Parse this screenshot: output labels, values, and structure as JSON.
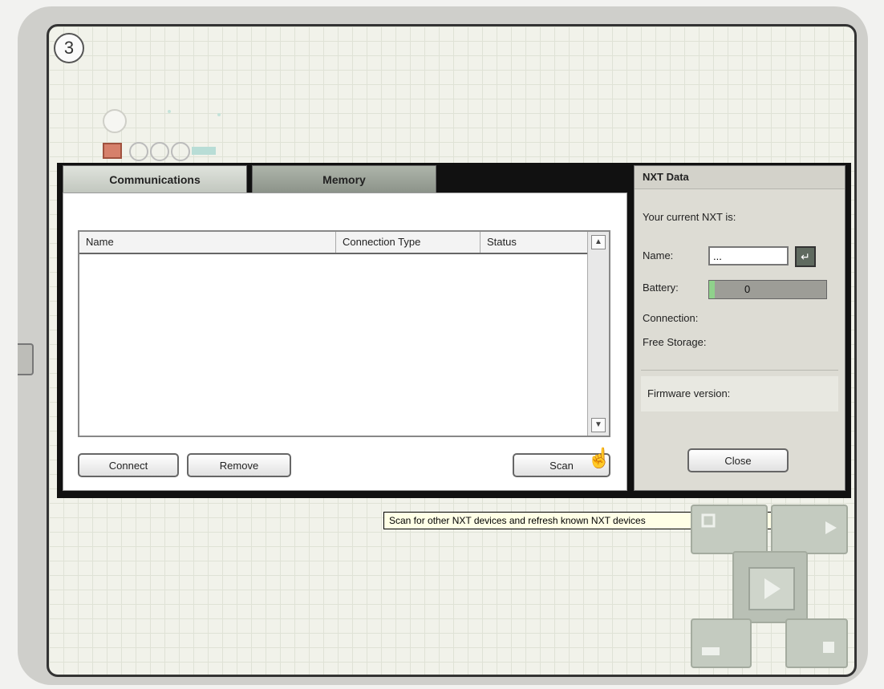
{
  "step_number": "3",
  "dialog": {
    "tabs": [
      "Communications",
      "Memory"
    ],
    "list": {
      "columns": [
        "Name",
        "Connection Type",
        "Status"
      ],
      "rows": []
    },
    "buttons": {
      "connect": "Connect",
      "remove": "Remove",
      "scan": "Scan"
    },
    "tooltip": "Scan for other NXT devices and refresh known NXT devices"
  },
  "nxt_panel": {
    "title": "NXT Data",
    "subtitle": "Your current NXT is:",
    "name_label": "Name:",
    "name_value": "...",
    "name_button": "↵",
    "battery_label": "Battery:",
    "battery_level": 0.05,
    "battery_text": "0",
    "connection_label": "Connection:",
    "free_storage_label": "Free Storage:",
    "message_label": "Firmware version:",
    "close_label": "Close"
  },
  "colors": {
    "battery_fill": "#8fd18b",
    "tab_active": "#d2d6cf",
    "tab_inactive": "#9aa197"
  },
  "icons": {
    "cursor": "hand-pointer-icon",
    "dpad": [
      "upload-icon",
      "download-icon",
      "run-icon",
      "save-icon",
      "stop-icon"
    ]
  }
}
